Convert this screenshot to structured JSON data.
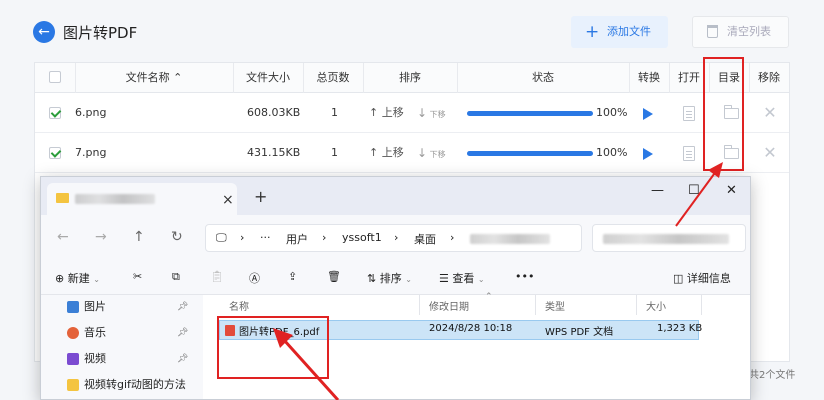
{
  "app": {
    "title": "图片转PDF",
    "add_file_label": "添加文件",
    "clear_list_label": "清空列表",
    "total_text": "共2个文件"
  },
  "table": {
    "headers": {
      "name": "文件名称",
      "size": "文件大小",
      "pages": "总页数",
      "order": "排序",
      "status": "状态",
      "convert": "转换",
      "open": "打开",
      "dir": "目录",
      "remove": "移除"
    },
    "sort_marker": "⌃",
    "move_up_label": "上移",
    "move_down_label": "下移",
    "rows": [
      {
        "name": "6.png",
        "size": "608.03KB",
        "pages": "1",
        "progress_text": "100%",
        "progress": 1.0,
        "checked": true
      },
      {
        "name": "7.png",
        "size": "431.15KB",
        "pages": "1",
        "progress_text": "100%",
        "progress": 1.0,
        "checked": true
      }
    ]
  },
  "explorer": {
    "tab_close": "×",
    "tab_plus": "+",
    "win_controls": {
      "min": "—",
      "max": "☐",
      "close": "✕"
    },
    "breadcrumbs": [
      "用户",
      "yssoft1",
      "桌面"
    ],
    "toolbar": {
      "new_label": "新建",
      "sort_label": "排序",
      "view_label": "查看",
      "more_label": "•••",
      "details_label": "详细信息"
    },
    "nav": [
      {
        "label": "图片",
        "icon": "pictures-icon",
        "color": "#3b7fd6"
      },
      {
        "label": "音乐",
        "icon": "music-icon",
        "color": "#e4623a"
      },
      {
        "label": "视频",
        "icon": "video-icon",
        "color": "#7b4bd1"
      },
      {
        "label": "视频转gif动图的方法",
        "icon": "folder-icon",
        "color": "#f4c440"
      }
    ],
    "columns": {
      "name": "名称",
      "date": "修改日期",
      "type": "类型",
      "size": "大小"
    },
    "files": [
      {
        "name": "图片转PDF_6.pdf",
        "date": "2024/8/28 10:18",
        "type": "WPS PDF 文档",
        "size": "1,323 KB"
      }
    ]
  },
  "colors": {
    "accent": "#2a78e4",
    "highlight": "#e02222",
    "checkmark": "#2a9d3a"
  }
}
